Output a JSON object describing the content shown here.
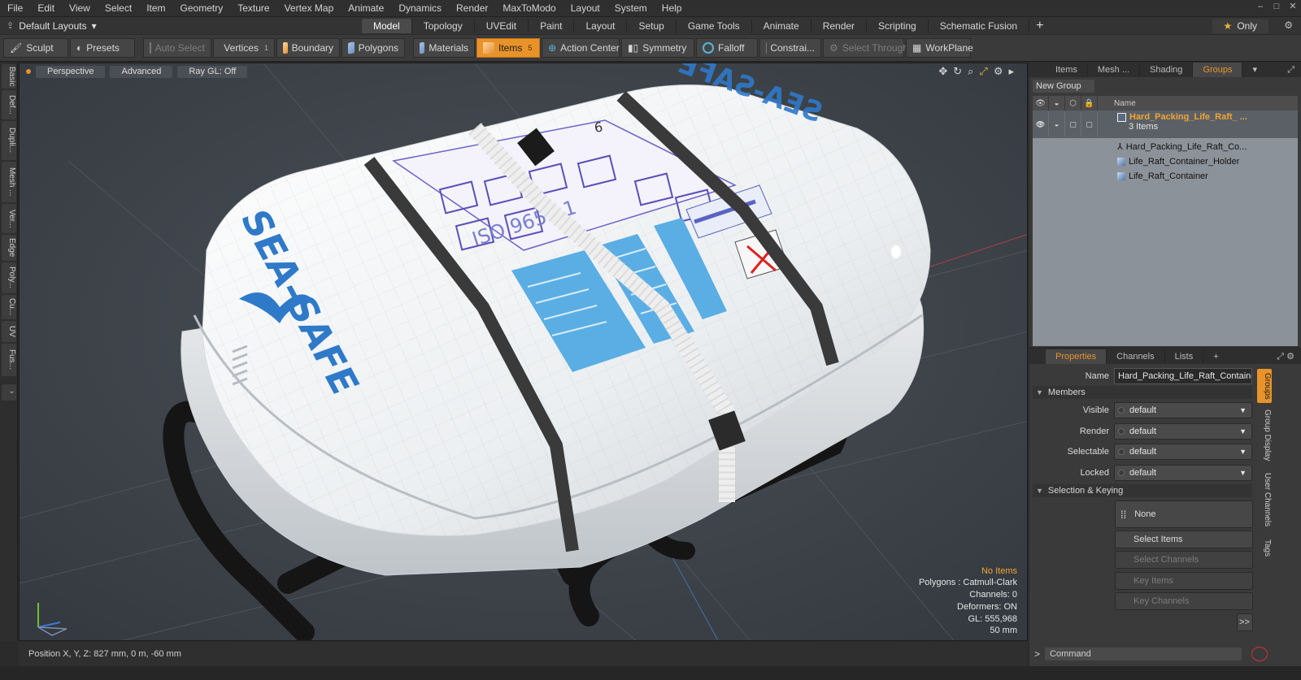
{
  "menu": [
    "File",
    "Edit",
    "View",
    "Select",
    "Item",
    "Geometry",
    "Texture",
    "Vertex Map",
    "Animate",
    "Dynamics",
    "Render",
    "MaxToModo",
    "Layout",
    "System",
    "Help"
  ],
  "layout": {
    "name": "Default Layouts",
    "tabs": [
      "Model",
      "Topology",
      "UVEdit",
      "Paint",
      "Layout",
      "Setup",
      "Game Tools",
      "Animate",
      "Render",
      "Scripting",
      "Schematic Fusion"
    ],
    "active_tab": "Model",
    "only_label": "Only"
  },
  "toolbar": {
    "sculpt": "Sculpt",
    "presets": "Presets",
    "auto_select": "Auto Select",
    "vertices": "Vertices",
    "vertices_count": "1",
    "boundary": "Boundary",
    "polygons": "Polygons",
    "materials": "Materials",
    "items": "Items",
    "items_count": "5",
    "action_center": "Action Center",
    "symmetry": "Symmetry",
    "falloff": "Falloff",
    "constraints": "Constrai...",
    "select_through": "Select Through",
    "workplane": "WorkPlane"
  },
  "left_tabs": [
    "Basic",
    "Def...",
    "Dupli...",
    "Mesh ...",
    "Ver...",
    "Edge",
    "Poly...",
    "Cu...",
    "UV",
    "Fus..."
  ],
  "viewport": {
    "view": "Perspective",
    "shading": "Advanced",
    "raygl": "Ray GL: Off",
    "info": {
      "selection": "No Items",
      "polygons": "Polygons : Catmull-Clark",
      "channels": "Channels: 0",
      "deformers": "Deformers: ON",
      "gl": "GL: 555,968",
      "grid": "50 mm"
    },
    "model_label": "SEA-SAFE",
    "iso_label": "ISO 9650.1",
    "big_number": "6"
  },
  "status": {
    "position": "Position X, Y, Z:  827 mm, 0 m, -60 mm"
  },
  "items_panel": {
    "tabs": [
      "Items",
      "Mesh ...",
      "Shading",
      "Groups"
    ],
    "active_tab": "Groups",
    "new_group": "New Group",
    "column_name": "Name",
    "rows": [
      {
        "name": "Hard_Packing_Life_Raft_ ...",
        "sub": "3 Items"
      },
      {
        "name": "Hard_Packing_Life_Raft_Co..."
      },
      {
        "name": "Life_Raft_Container_Holder"
      },
      {
        "name": "Life_Raft_Container"
      }
    ]
  },
  "properties_panel": {
    "tabs": [
      "Properties",
      "Channels",
      "Lists"
    ],
    "active_tab": "Properties",
    "name_label": "Name",
    "name_value": "Hard_Packing_Life_Raft_Container",
    "members_section": "Members",
    "fields": [
      {
        "label": "Visible",
        "value": "default"
      },
      {
        "label": "Render",
        "value": "default"
      },
      {
        "label": "Selectable",
        "value": "default"
      },
      {
        "label": "Locked",
        "value": "default"
      }
    ],
    "keying_section": "Selection & Keying",
    "none_label": "None",
    "buttons": [
      "Select Items",
      "Select Channels",
      "Key Items",
      "Key Channels"
    ],
    "side_tabs": [
      "Groups",
      "Group Display",
      "User Channels",
      "Tags"
    ],
    "more": ">>"
  },
  "command": {
    "placeholder": "Command"
  },
  "colors": {
    "accent": "#e8932a",
    "viewport_bg": "#3d4248",
    "panel": "#3a3a3a"
  }
}
